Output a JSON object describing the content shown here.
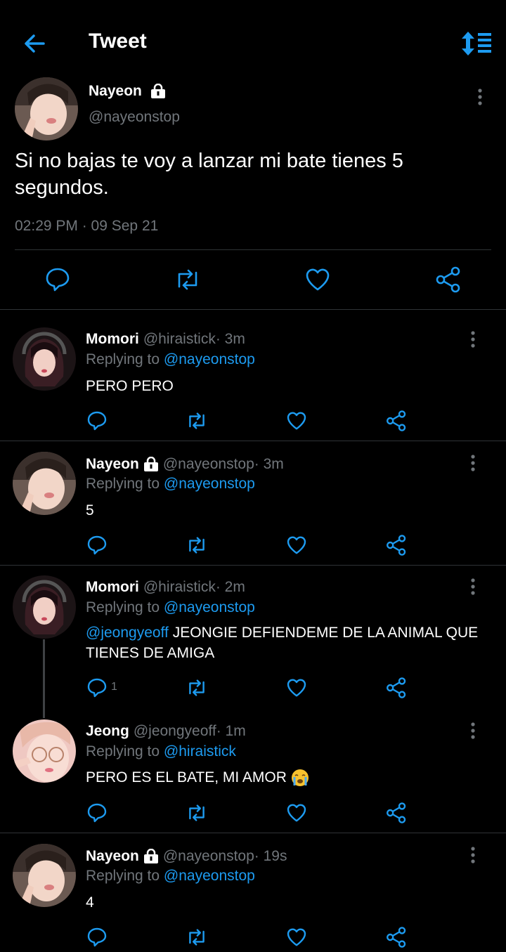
{
  "topbar": {
    "title": "Tweet"
  },
  "main_tweet": {
    "name": "Nayeon",
    "handle": "@nayeonstop",
    "text": "Si no bajas te voy a lanzar mi bate tienes 5 segundos.",
    "timestamp": "02:29 PM · 09 Sep 21"
  },
  "replies": [
    {
      "name": "Momori",
      "handle": "@hiraistick",
      "time": " · 3m",
      "replying_label": "Replying to ",
      "replying_to": "@nayeonstop",
      "mention": "",
      "text": "PERO PERO",
      "reply_count": ""
    },
    {
      "name": "Nayeon",
      "handle": "@nayeonstop",
      "time": " · 3m",
      "replying_label": "Replying to ",
      "replying_to": "@nayeonstop",
      "mention": "",
      "text": "5",
      "reply_count": ""
    },
    {
      "name": "Momori",
      "handle": "@hiraistick",
      "time": " · 2m",
      "replying_label": "Replying to ",
      "replying_to": "@nayeonstop",
      "mention": "@jeongyeoff",
      "text": " JEONGIE DEFIENDEME DE LA ANIMAL QUE TIENES DE AMIGA",
      "reply_count": "1"
    },
    {
      "name": "Jeong",
      "handle": "@jeongyeoff",
      "time": " · 1m",
      "replying_label": "Replying to ",
      "replying_to": "@hiraistick",
      "mention": "",
      "text": "PERO ES EL BATE, MI AMOR ",
      "reply_count": ""
    },
    {
      "name": "Nayeon",
      "handle": "@nayeonstop",
      "time": " · 19s",
      "replying_label": "Replying to ",
      "replying_to": "@nayeonstop",
      "mention": "",
      "text": "4",
      "reply_count": ""
    }
  ],
  "colors": {
    "background": "#000000",
    "accent": "#1d9bf0",
    "muted": "#71767b",
    "divider": "#2f3336"
  },
  "icons": [
    "back-arrow-icon",
    "sort-icon",
    "lock-icon",
    "more-icon",
    "reply-icon",
    "retweet-icon",
    "like-icon",
    "share-icon",
    "crying-emoji-icon"
  ]
}
